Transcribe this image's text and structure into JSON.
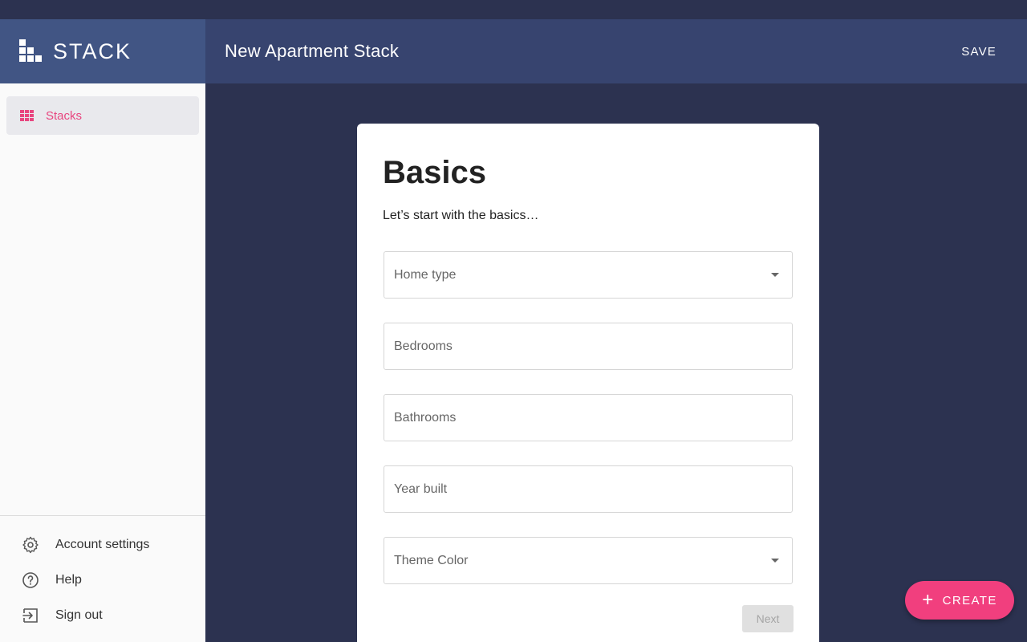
{
  "brand": {
    "name": "STACK",
    "icon": "stack-logo-icon"
  },
  "header": {
    "title": "New Apartment Stack",
    "save_label": "SAVE"
  },
  "sidebar": {
    "items": [
      {
        "label": "Stacks",
        "icon": "grid-icon",
        "active": true
      }
    ],
    "bottom": [
      {
        "label": "Account settings",
        "icon": "gear-icon"
      },
      {
        "label": "Help",
        "icon": "help-circle-icon"
      },
      {
        "label": "Sign out",
        "icon": "sign-out-icon"
      }
    ]
  },
  "form": {
    "title": "Basics",
    "subtitle": "Let’s start with the basics…",
    "fields": [
      {
        "label": "Home type",
        "type": "select"
      },
      {
        "label": "Bedrooms",
        "type": "text"
      },
      {
        "label": "Bathrooms",
        "type": "text"
      },
      {
        "label": "Year built",
        "type": "text"
      },
      {
        "label": "Theme Color",
        "type": "select"
      }
    ],
    "next_label": "Next"
  },
  "fab": {
    "label": "CREATE",
    "icon": "plus-icon"
  },
  "colors": {
    "accent": "#f13f7e",
    "brand_bar": "#415584",
    "app_bar": "#37446f",
    "background": "#2c3250"
  }
}
